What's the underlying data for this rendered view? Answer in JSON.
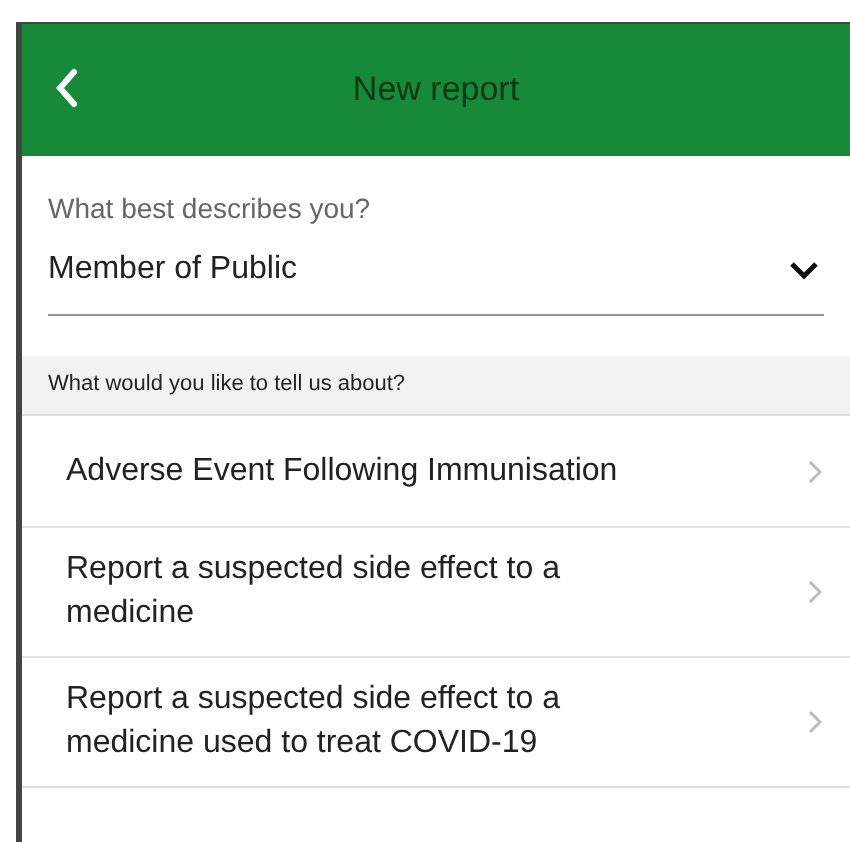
{
  "header": {
    "title": "New report"
  },
  "describe": {
    "label": "What best describes you?",
    "value": "Member of Public"
  },
  "section": {
    "heading": "What would you like to tell us about?"
  },
  "options": [
    {
      "label": "Adverse Event Following Immunisation"
    },
    {
      "label": "Report a suspected side effect to a medicine"
    },
    {
      "label": "Report a suspected side effect to a medicine used to treat COVID-19"
    }
  ]
}
